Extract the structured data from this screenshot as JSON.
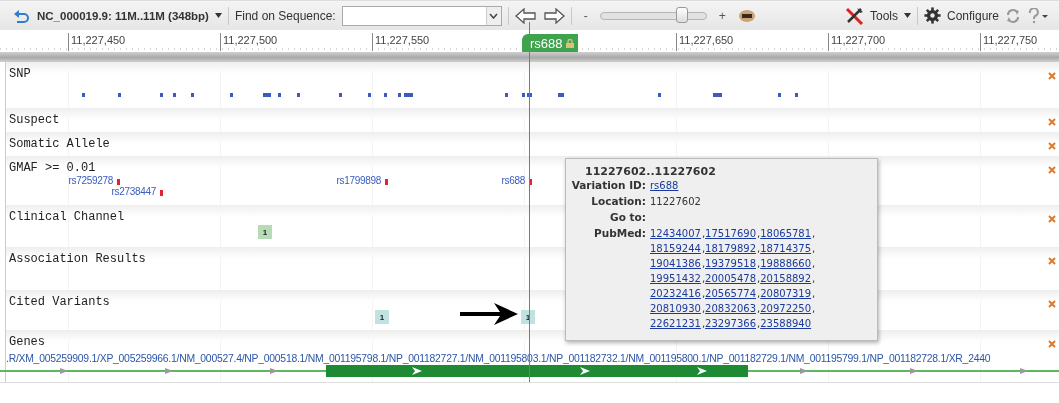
{
  "toolbar": {
    "location": "NC_000019.9: 11M..11M (348bp)",
    "find_label": "Find on Sequence:",
    "zoom_out": "-",
    "zoom": {
      "level": 0.77
    },
    "zoom_in": "+",
    "tools": "Tools",
    "configure": "Configure"
  },
  "ruler": {
    "ticks": [
      "11,227,450",
      "11,227,500",
      "11,227,550",
      "11,227,650",
      "11,227,700",
      "11,227,750"
    ],
    "marker": "rs688"
  },
  "tracks": [
    {
      "kind": "snp",
      "title": "SNP"
    },
    {
      "kind": "empty",
      "title": "Suspect"
    },
    {
      "kind": "empty",
      "title": "Somatic Allele"
    },
    {
      "kind": "variants",
      "title": "GMAF >= 0.01",
      "features": [
        {
          "label": "rs7259278"
        },
        {
          "label": "rs2738447"
        },
        {
          "label": "rs1799898"
        },
        {
          "label": "rs688"
        }
      ]
    },
    {
      "kind": "badges",
      "title": "Clinical Channel",
      "badges": [
        {
          "label": "1",
          "color": "#b7dab7"
        }
      ]
    },
    {
      "kind": "empty",
      "title": "Association Results"
    },
    {
      "kind": "badges",
      "title": "Cited Variants",
      "badges": [
        {
          "label": "1",
          "color": "#c2e2e2"
        },
        {
          "label": "1",
          "color": "#c2e2e2"
        }
      ]
    },
    {
      "kind": "genes",
      "title": "Genes",
      "transcripts": ".R/XM_005259909.1/XP_005259966.1/NM_000527.4/NP_000518.1/NM_001195798.1/NP_001182727.1/NM_001195803.1/NP_001182732.1/NM_001195800.1/NP_001182729.1/NM_001195799.1/NP_001182728.1/XR_2440"
    }
  ],
  "tooltip": {
    "title": "11227602..11227602",
    "fields": [
      {
        "label": "Variation ID:",
        "links": [
          "rs688"
        ]
      },
      {
        "label": "Location:",
        "value": "11227602"
      },
      {
        "label": "Go to:"
      },
      {
        "label": "PubMed:",
        "separator": ",",
        "links": [
          "12434007",
          "17517690",
          "18065781",
          "18159244",
          "18179892",
          "18714375",
          "19041386",
          "19379518",
          "19888660",
          "19951432",
          "20005478",
          "20158892",
          "20232416",
          "20565774",
          "20807319",
          "20810930",
          "20832063",
          "20972250",
          "22621231",
          "23297366",
          "23588940"
        ]
      }
    ]
  }
}
